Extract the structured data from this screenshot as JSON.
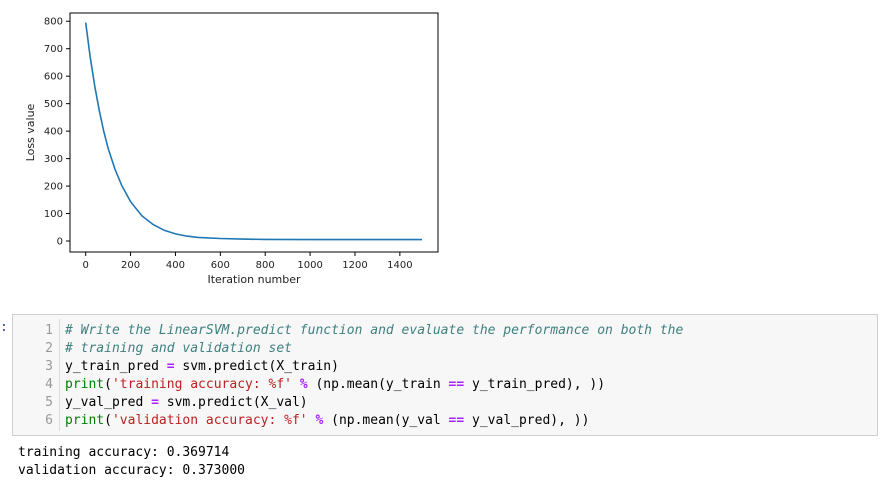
{
  "chart_data": {
    "type": "line",
    "xlabel": "Iteration number",
    "ylabel": "Loss value",
    "xlim": [
      -70,
      1570
    ],
    "ylim": [
      -40,
      830
    ],
    "xticks": [
      0,
      200,
      400,
      600,
      800,
      1000,
      1200,
      1400
    ],
    "yticks": [
      0,
      100,
      200,
      300,
      400,
      500,
      600,
      700,
      800
    ],
    "grid": false,
    "color": "#1f77b4",
    "series": [
      {
        "x": [
          0,
          20,
          40,
          60,
          80,
          100,
          130,
          160,
          200,
          250,
          300,
          350,
          400,
          450,
          500,
          600,
          700,
          800,
          1000,
          1200,
          1400,
          1499
        ],
        "values": [
          795,
          670,
          565,
          476,
          400,
          338,
          262,
          203,
          143,
          92,
          60,
          39,
          26,
          18,
          13,
          9,
          7,
          6,
          5,
          5,
          5,
          5
        ]
      }
    ]
  },
  "cell": {
    "prompt": ":",
    "line_numbers": [
      "1",
      "2",
      "3",
      "4",
      "5",
      "6"
    ],
    "lines": [
      [
        {
          "t": "# Write the LinearSVM.predict function and evaluate the performance on both the",
          "c": "cm"
        }
      ],
      [
        {
          "t": "# training and validation set",
          "c": "cm"
        }
      ],
      [
        {
          "t": "y_train_pred ",
          "c": ""
        },
        {
          "t": "=",
          "c": "op"
        },
        {
          "t": " svm.predict(X_train)",
          "c": ""
        }
      ],
      [
        {
          "t": "print",
          "c": "kw"
        },
        {
          "t": "(",
          "c": ""
        },
        {
          "t": "'training accuracy: %f'",
          "c": "st"
        },
        {
          "t": " ",
          "c": ""
        },
        {
          "t": "%",
          "c": "op"
        },
        {
          "t": " (np.mean(y_train ",
          "c": ""
        },
        {
          "t": "==",
          "c": "op"
        },
        {
          "t": " y_train_pred), ))",
          "c": ""
        }
      ],
      [
        {
          "t": "y_val_pred ",
          "c": ""
        },
        {
          "t": "=",
          "c": "op"
        },
        {
          "t": " svm.predict(X_val)",
          "c": ""
        }
      ],
      [
        {
          "t": "print",
          "c": "kw"
        },
        {
          "t": "(",
          "c": ""
        },
        {
          "t": "'validation accuracy: %f'",
          "c": "st"
        },
        {
          "t": " ",
          "c": ""
        },
        {
          "t": "%",
          "c": "op"
        },
        {
          "t": " (np.mean(y_val ",
          "c": ""
        },
        {
          "t": "==",
          "c": "op"
        },
        {
          "t": " y_val_pred), ))",
          "c": ""
        }
      ]
    ]
  },
  "output": {
    "lines": [
      "training accuracy: 0.369714",
      "validation accuracy: 0.373000"
    ]
  }
}
